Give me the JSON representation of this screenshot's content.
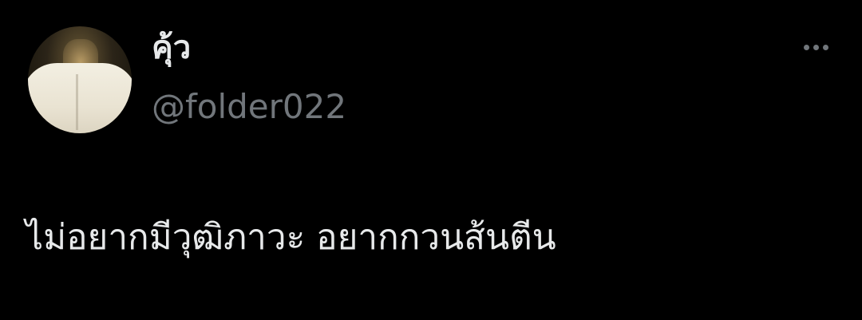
{
  "tweet": {
    "author": {
      "display_name": "คุ้ว",
      "handle": "@folder022",
      "avatar": "avatar-photo"
    },
    "menu_icon": "more-options-icon",
    "text": "ไม่อยากมีวุฒิภาวะ อยากกวนส้นตีน"
  },
  "colors": {
    "background": "#000000",
    "primary_text": "#e7e9ea",
    "secondary_text": "#71767b"
  }
}
